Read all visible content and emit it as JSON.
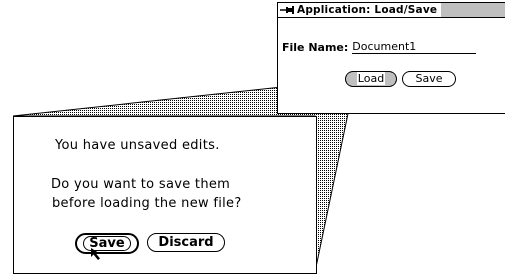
{
  "background_window": {
    "title": "Application:  Load/Save",
    "file_name_label": "File Name:",
    "file_name_value": "Document1",
    "load_button": "Load",
    "save_button": "Save"
  },
  "dialog": {
    "message_line1": "You have unsaved edits.",
    "message_line2": "Do you want to save them",
    "message_line3": "before loading the new file?",
    "save_button": "Save",
    "discard_button": "Discard"
  },
  "icons": {
    "window_menu": "pushpin-icon",
    "cursor": "arrow-cursor-icon"
  }
}
